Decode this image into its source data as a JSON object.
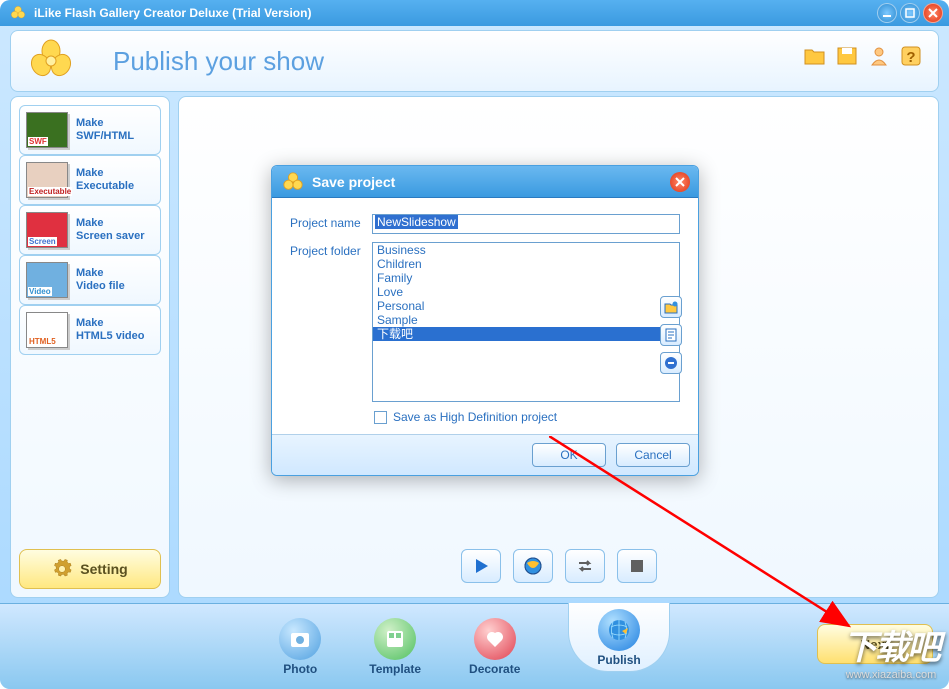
{
  "titlebar": {
    "title": "iLike Flash Gallery Creator Deluxe (Trial Version)"
  },
  "header": {
    "title": "Publish your show"
  },
  "sidebar": {
    "items": [
      {
        "line1": "Make",
        "line2": "SWF/HTML",
        "tag": "SWF",
        "color": "#e03030",
        "bg": "#3a7020"
      },
      {
        "line1": "Make",
        "line2": "Executable",
        "tag": "Executable",
        "color": "#c02020",
        "bg": "#e8d0c0"
      },
      {
        "line1": "Make",
        "line2": "Screen saver",
        "tag": "Screen",
        "color": "#4070d0",
        "bg": "#e03040"
      },
      {
        "line1": "Make",
        "line2": "Video file",
        "tag": "Video",
        "color": "#3090d0",
        "bg": "#70b0e0"
      },
      {
        "line1": "Make",
        "line2": "HTML5 video",
        "tag": "HTML5",
        "color": "#e06020",
        "bg": "#fff"
      }
    ],
    "setting": "Setting"
  },
  "dialog": {
    "title": "Save project",
    "name_label": "Project name",
    "name_value": "NewSlideshow",
    "folder_label": "Project folder",
    "folders": [
      "Business",
      "Children",
      "Family",
      "Love",
      "Personal",
      "Sample",
      "下载吧"
    ],
    "selected_index": 6,
    "hd_label": "Save as High Definition project",
    "ok": "OK",
    "cancel": "Cancel"
  },
  "nav": {
    "items": [
      {
        "label": "Photo"
      },
      {
        "label": "Template"
      },
      {
        "label": "Decorate"
      },
      {
        "label": "Publish"
      }
    ],
    "next": "Next"
  },
  "watermark": {
    "cn": "下载吧",
    "url": "www.xiazaiba.com"
  }
}
